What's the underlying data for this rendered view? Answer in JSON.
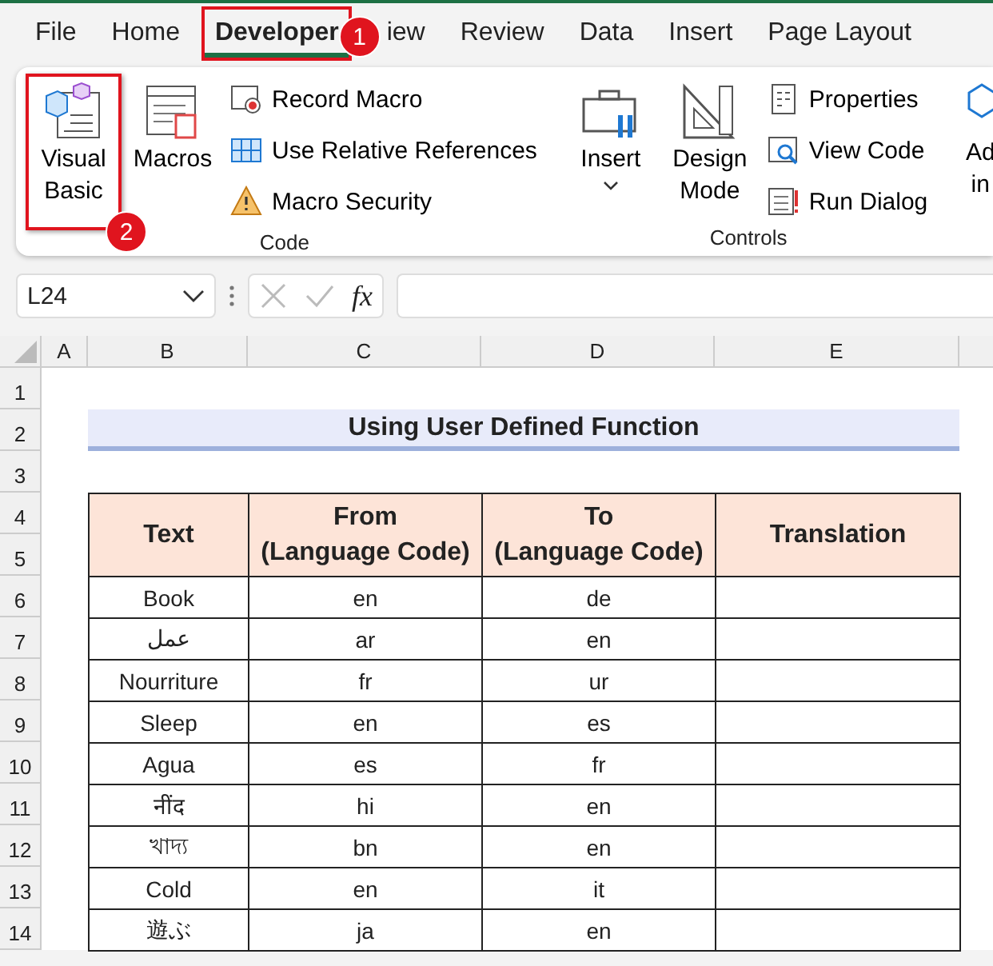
{
  "menu_tabs": [
    {
      "label": "File",
      "selected": false,
      "highlighted": false
    },
    {
      "label": "Home",
      "selected": false,
      "highlighted": false
    },
    {
      "label": "Developer",
      "selected": true,
      "highlighted": true,
      "badge": "1"
    },
    {
      "label": "iew",
      "selected": false,
      "highlighted": false
    },
    {
      "label": "Review",
      "selected": false,
      "highlighted": false
    },
    {
      "label": "Data",
      "selected": false,
      "highlighted": false
    },
    {
      "label": "Insert",
      "selected": false,
      "highlighted": false
    },
    {
      "label": "Page Layout",
      "selected": false,
      "highlighted": false
    }
  ],
  "ribbon_groups": [
    {
      "label": "Code",
      "large_buttons": [
        {
          "label": "Visual Basic",
          "highlighted": true,
          "badge": "2"
        },
        {
          "label": "Macros",
          "highlighted": false
        }
      ],
      "small_buttons": [
        {
          "label": "Record Macro"
        },
        {
          "label": "Use Relative References"
        },
        {
          "label": "Macro Security"
        }
      ]
    },
    {
      "label": "Controls",
      "large_buttons": [
        {
          "label": "Insert",
          "highlighted": false,
          "dropdown": true
        },
        {
          "label": "Design Mode",
          "highlighted": false
        }
      ],
      "small_buttons": [
        {
          "label": "Properties"
        },
        {
          "label": "View Code"
        },
        {
          "label": "Run Dialog"
        }
      ]
    }
  ],
  "addins_button": {
    "label": "Ad in"
  },
  "formula_bar": {
    "name_box": "L24",
    "function_label": "fx"
  },
  "columns": [
    "A",
    "B",
    "C",
    "D",
    "E"
  ],
  "rows": [
    "1",
    "2",
    "3",
    "4",
    "5",
    "6",
    "7",
    "8",
    "9",
    "10",
    "11",
    "12",
    "13",
    "14"
  ],
  "title": "Using User Defined Function",
  "table": {
    "columns": [
      "Text",
      "From\n(Language Code)",
      "To\n(Language Code)",
      "Translation"
    ],
    "rows": [
      [
        "Book",
        "en",
        "de",
        ""
      ],
      [
        "عمل",
        "ar",
        "en",
        ""
      ],
      [
        "Nourriture",
        "fr",
        "ur",
        ""
      ],
      [
        "Sleep",
        "en",
        "es",
        ""
      ],
      [
        "Agua",
        "es",
        "fr",
        ""
      ],
      [
        "नींद",
        "hi",
        "en",
        ""
      ],
      [
        "খাদ্য",
        "bn",
        "en",
        ""
      ],
      [
        "Cold",
        "en",
        "it",
        ""
      ],
      [
        "遊ぶ",
        "ja",
        "en",
        ""
      ]
    ]
  }
}
